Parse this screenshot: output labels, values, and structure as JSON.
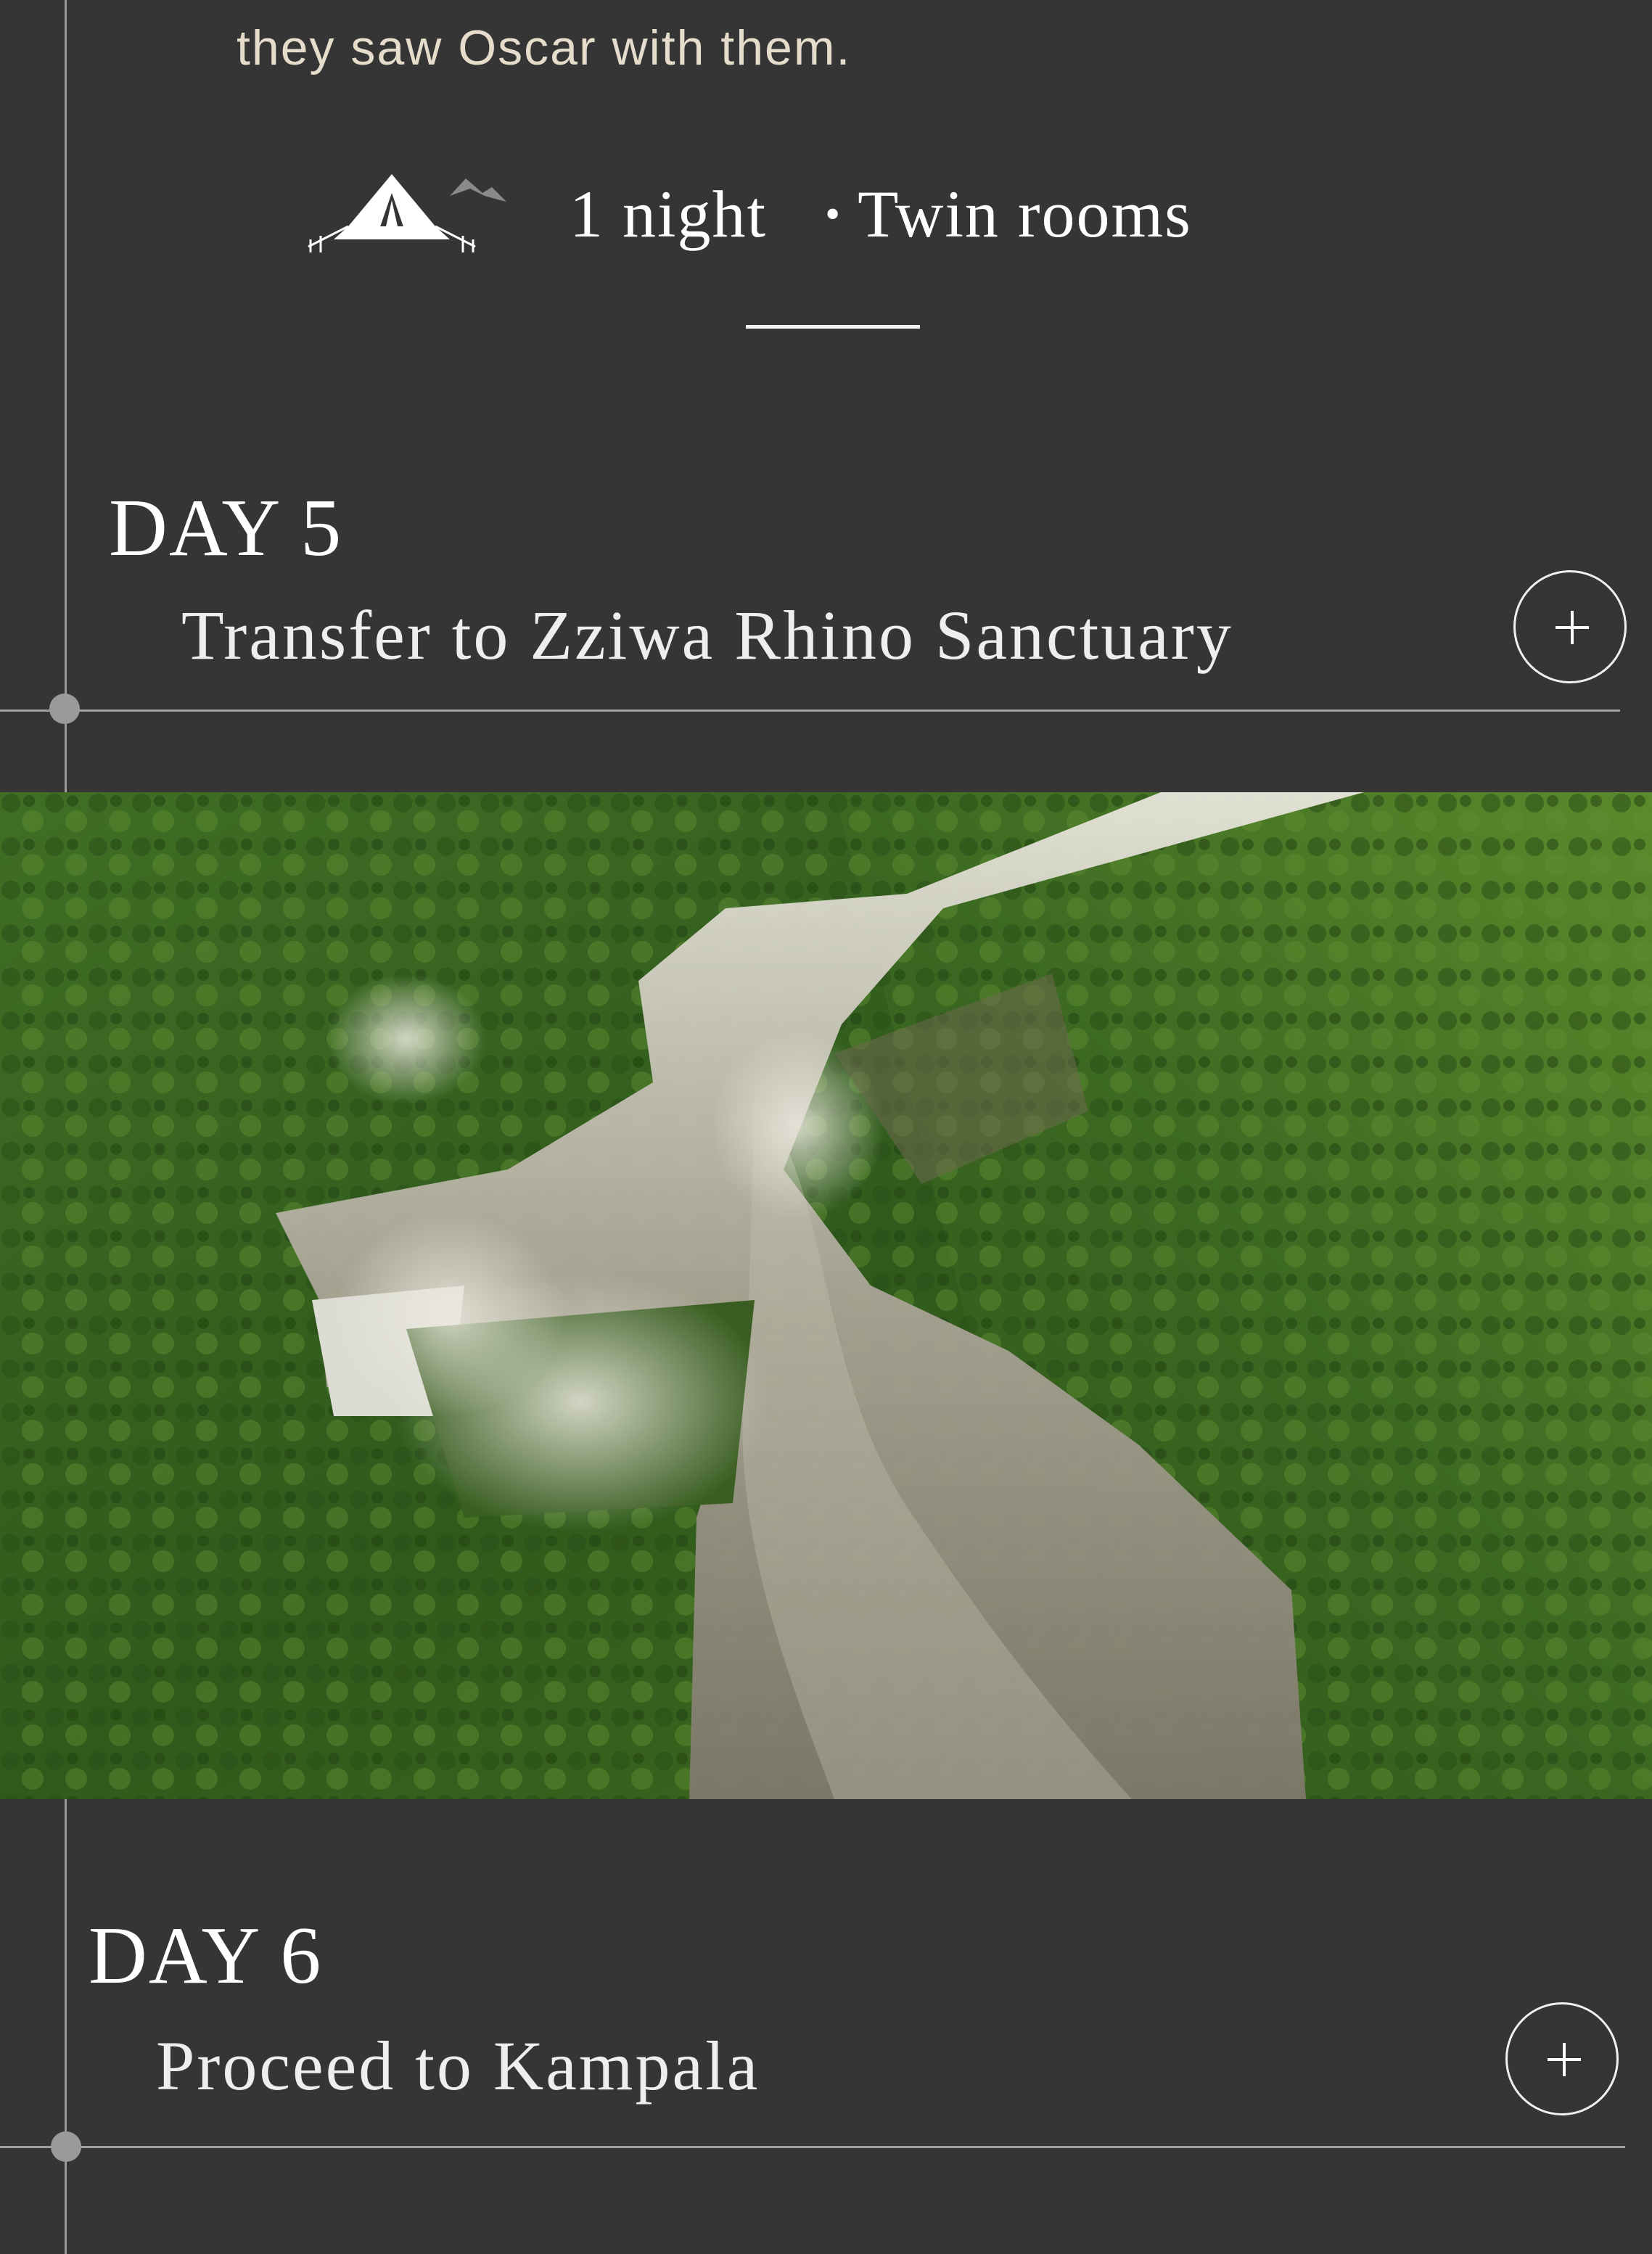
{
  "intro": {
    "text": "they saw Oscar with them."
  },
  "stay": {
    "icon": "tent-icon",
    "nights": "1 night",
    "separator": "•",
    "rooms": "Twin rooms"
  },
  "days": [
    {
      "label": "DAY 5",
      "title": "Transfer to Zziwa Rhino Sanctuary",
      "expand_icon": "plus-icon"
    },
    {
      "label": "DAY 6",
      "title": "Proceed to Kampala",
      "expand_icon": "plus-icon"
    }
  ],
  "photo": {
    "subject": "aerial view of waterfalls and river gorge in green forest"
  },
  "colors": {
    "background": "#353536",
    "text": "#ffffff",
    "intro_text": "#e6dccb",
    "timeline": "#9a9a9a"
  }
}
